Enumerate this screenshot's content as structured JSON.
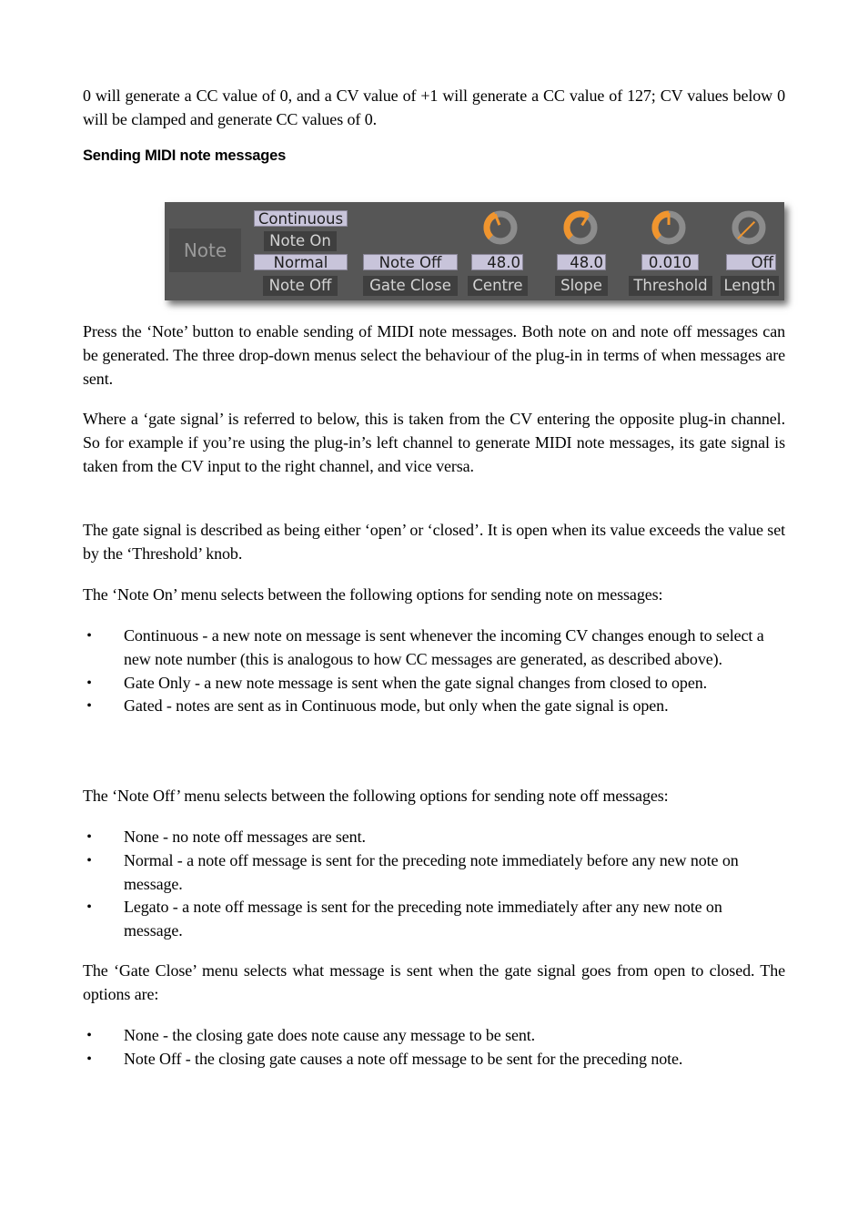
{
  "intro": {
    "text": "0 will generate a CC value of 0, and a CV value of +1 will generate a CC value of 127; CV values below 0 will be clamped and generate CC values of 0."
  },
  "section_heading": "Sending MIDI note messages",
  "plugin_panel": {
    "note_button": "Note",
    "note_on": {
      "value": "Continuous",
      "label": "Note On"
    },
    "note_off": {
      "value": "Normal",
      "label": "Note Off"
    },
    "gate_close": {
      "value": "Note Off",
      "label": "Gate Close"
    },
    "knobs": [
      {
        "id": "centre",
        "value": "48.0",
        "label": "Centre",
        "position": 0.42
      },
      {
        "id": "slope",
        "value": "48.0",
        "label": "Slope",
        "position": 0.62
      },
      {
        "id": "threshold",
        "value": "0.010",
        "label": "Threshold",
        "position": 0.5
      },
      {
        "id": "length",
        "value": "Off",
        "label": "Length",
        "position": 0.0
      }
    ],
    "colors": {
      "panel_bg": "#565656",
      "knob_active": "#f0952e",
      "knob_track": "#8c8c8c",
      "field_bg": "#c8c4da",
      "label_bg": "#3f3f3f"
    }
  },
  "paragraphs": {
    "p1": "Press the ‘Note’ button to enable sending of MIDI note messages. Both note on and note off messages can be generated. The three drop-down menus select the behaviour of the plug-in in terms of when messages are sent.",
    "p2": "Where a ‘gate signal’ is referred to below, this is taken from the CV entering the opposite plug-in channel. So for example if you’re using the plug-in’s left channel to generate MIDI note messages, its gate signal is taken from the CV input to the right channel, and vice versa.",
    "p3": "The gate signal is described as being either ‘open’ or ‘closed’. It is open when its value exceeds the value set by the ‘Threshold’ knob.",
    "p4": "The ‘Note On’ menu selects between the following options for sending note on messages:",
    "p5": "The ‘Note Off’ menu selects between the following options for sending note off messages:",
    "p6": "The ‘Gate Close’ menu selects what message is sent when the gate signal goes from open to closed. The options are:"
  },
  "note_on_options": [
    "Continuous - a new note on message is sent whenever the incoming CV changes enough to select a new note number (this is analogous to how CC messages are generated, as described above).",
    "Gate Only - a new note message is sent when the gate signal changes from closed to open.",
    "Gated - notes are sent as in Continuous mode, but only when the gate signal is open."
  ],
  "note_off_options": [
    "None - no note off messages are sent.",
    "Normal - a note off message is sent for the preceding note immediately before any new note on message.",
    "Legato - a note off message is sent for the preceding note immediately after any new note on message."
  ],
  "gate_close_options": [
    "None - the closing gate does note cause any message to be sent.",
    "Note Off - the closing gate causes a note off message to be sent for the preceding note."
  ],
  "bullet_glyph": "•"
}
